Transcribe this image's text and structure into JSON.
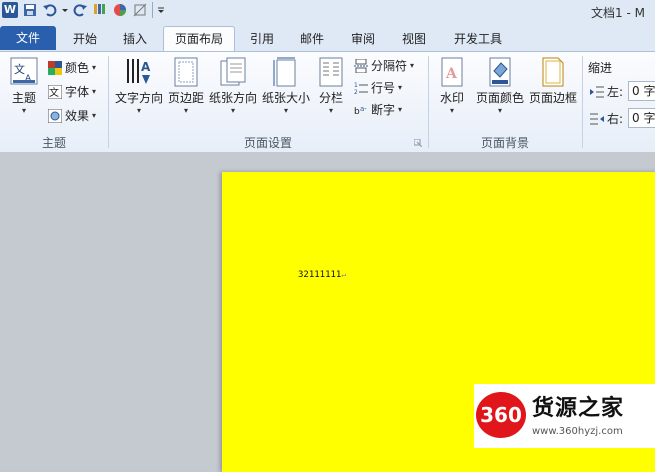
{
  "window": {
    "title": "文档1 - M"
  },
  "quick_access": {
    "app_icon": "W"
  },
  "tabs": [
    {
      "label": "文件"
    },
    {
      "label": "开始"
    },
    {
      "label": "插入"
    },
    {
      "label": "页面布局"
    },
    {
      "label": "引用"
    },
    {
      "label": "邮件"
    },
    {
      "label": "审阅"
    },
    {
      "label": "视图"
    },
    {
      "label": "开发工具"
    }
  ],
  "ribbon": {
    "themes_group": {
      "label": "主题",
      "theme_button": "主题",
      "colors": "颜色",
      "fonts": "字体",
      "effects": "效果"
    },
    "page_setup_group": {
      "label": "页面设置",
      "text_direction": "文字方向",
      "margins": "页边距",
      "orientation": "纸张方向",
      "size": "纸张大小",
      "columns": "分栏",
      "breaks": "分隔符",
      "line_numbers": "行号",
      "hyphenation": "断字"
    },
    "page_background_group": {
      "label": "页面背景",
      "watermark": "水印",
      "page_color": "页面颜色",
      "page_borders": "页面边框"
    },
    "paragraph_group": {
      "indent_label": "缩进",
      "left_label": "左:",
      "left_value": "0 字",
      "right_label": "右:",
      "right_value": "0 字"
    }
  },
  "document": {
    "background_color": "#ffff00",
    "text": "32111111",
    "pilcrow": "↵"
  },
  "watermark_overlay": {
    "badge": "360",
    "name": "货源之家",
    "url": "www.360hyzj.com"
  },
  "colors": {
    "file_tab": "#2a5fad",
    "accent_red": "#e0161b"
  }
}
